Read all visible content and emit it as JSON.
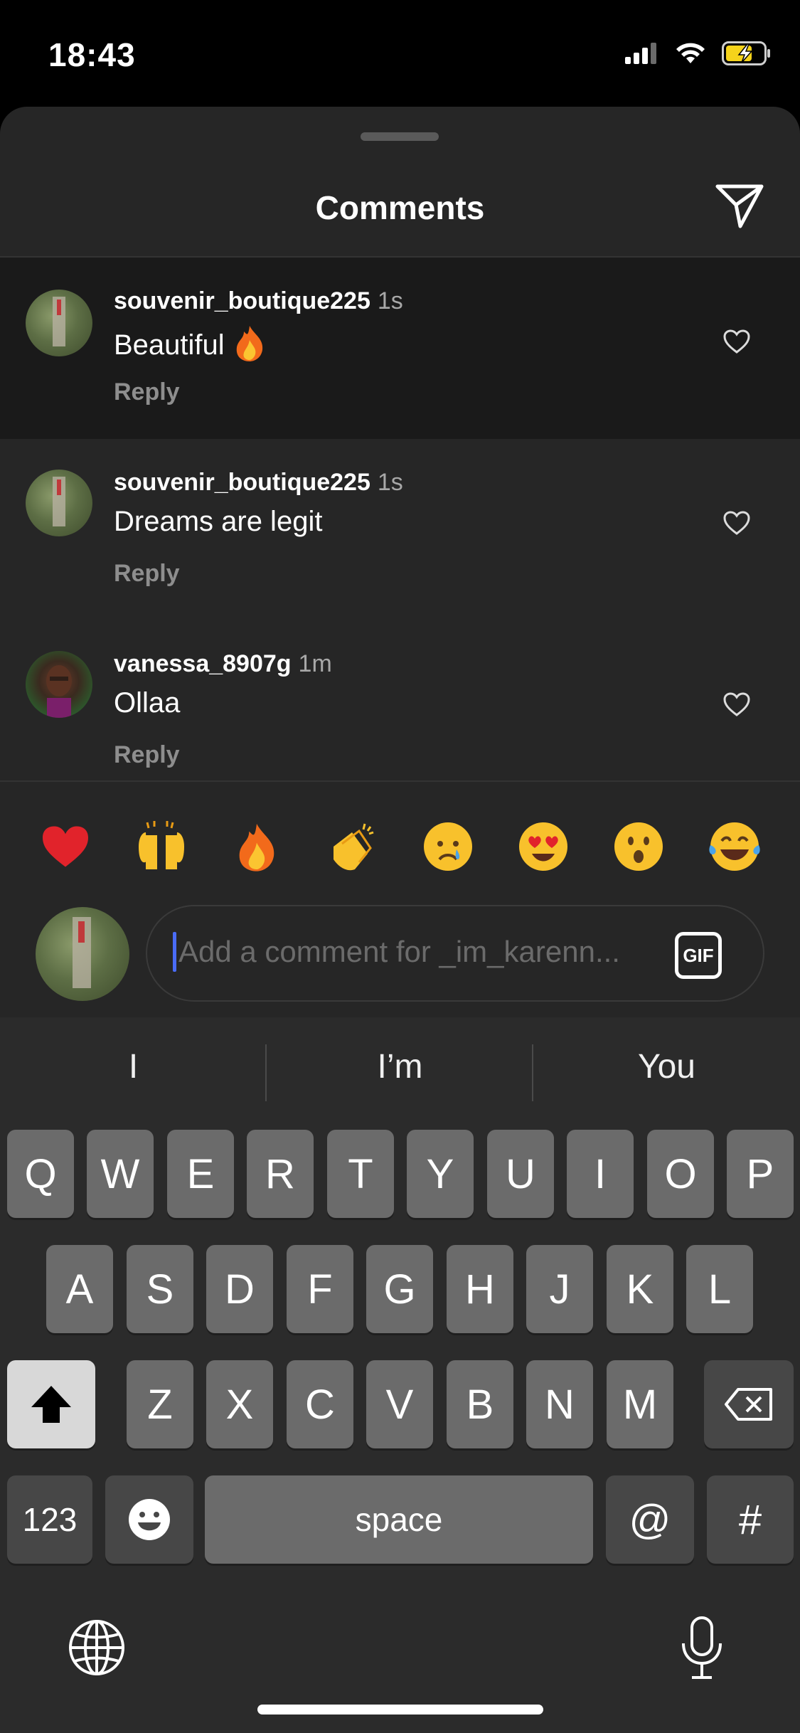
{
  "status_bar": {
    "time": "18:43"
  },
  "sheet": {
    "title": "Comments"
  },
  "comments": [
    {
      "username": "souvenir_boutique225",
      "time": "1s",
      "text": "Beautiful ",
      "emoji": "fire",
      "reply": "Reply"
    },
    {
      "username": "souvenir_boutique225",
      "time": "1s",
      "text": "Dreams are legit",
      "reply": "Reply"
    },
    {
      "username": "vanessa_8907g",
      "time": "1m",
      "text": "Ollaa",
      "reply": "Reply"
    }
  ],
  "quick_reactions": [
    "red-heart",
    "raising-hands",
    "fire",
    "clapping-hands",
    "crying-face",
    "heart-eyes-face",
    "surprised-face",
    "tears-of-joy-face"
  ],
  "composer": {
    "placeholder": "Add a comment for _im_karenn...",
    "gif_label": "GIF"
  },
  "keyboard": {
    "suggestions": [
      "I",
      "I’m",
      "You"
    ],
    "row1": [
      "Q",
      "W",
      "E",
      "R",
      "T",
      "Y",
      "U",
      "I",
      "O",
      "P"
    ],
    "row2": [
      "A",
      "S",
      "D",
      "F",
      "G",
      "H",
      "J",
      "K",
      "L"
    ],
    "row3": [
      "Z",
      "X",
      "C",
      "V",
      "B",
      "N",
      "M"
    ],
    "numbers_label": "123",
    "space_label": "space",
    "at_label": "@",
    "hash_label": "#"
  },
  "colors": {
    "background": "#262626",
    "highlight": "#1a1a1a",
    "caret": "#4a6cf7",
    "secondary_text": "#8e8e8e"
  }
}
